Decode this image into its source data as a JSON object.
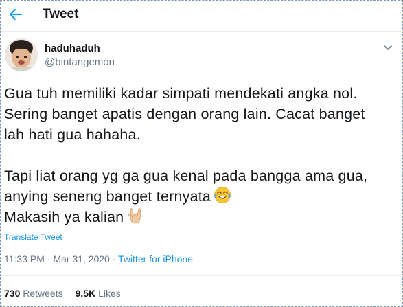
{
  "header": {
    "title": "Tweet",
    "back_icon": "arrow-left-icon",
    "accent": "#1da1f2"
  },
  "author": {
    "display_name": "haduhaduh",
    "handle": "@bintangemon",
    "avatar_icon": "avatar-photo"
  },
  "tweet": {
    "lines": [
      "Gua tuh memiliki kadar simpati mendekati angka nol.",
      "Sering banget apatis dengan orang lain. Cacat banget",
      "lah hati gua hahaha.",
      "Tapi liat orang yg ga gua kenal pada bangga ama gua,",
      "anying seneng banget ternyata",
      "Makasih ya kalian"
    ],
    "emoji_laugh": "face-with-tears-of-joy-icon",
    "emoji_hand": "sign-of-horns-icon",
    "translate_label": "Translate Tweet"
  },
  "meta": {
    "time": "11:33 PM",
    "separator": " · ",
    "date": "Mar 31, 2020",
    "source": "Twitter for iPhone"
  },
  "stats": {
    "retweets_count": "730",
    "retweets_label": "Retweets",
    "likes_count": "9.5K",
    "likes_label": "Likes"
  },
  "colors": {
    "text": "#14171a",
    "muted": "#657786",
    "link": "#1b95e0",
    "border": "#e6ecf0"
  }
}
